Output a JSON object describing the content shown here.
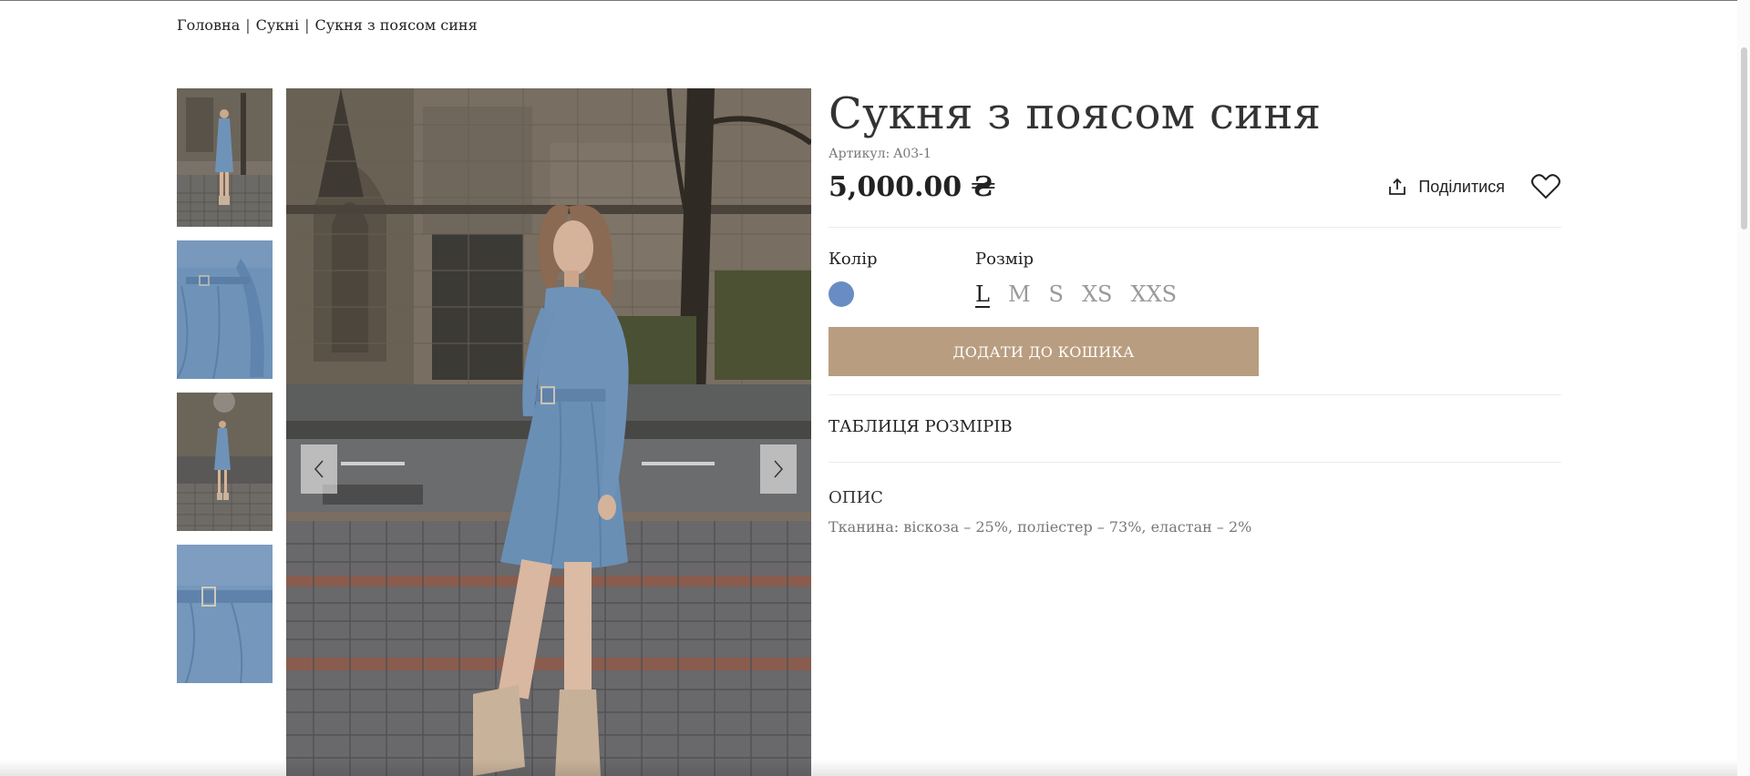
{
  "breadcrumb": {
    "home": "Головна",
    "category": "Сукні",
    "current": "Сукня з поясом синя",
    "separator": "|"
  },
  "product": {
    "title": "Сукня з поясом синя",
    "sku_label": "Артикул:",
    "sku": "A03-1",
    "price": "5,000.00 ₴",
    "share_label": "Поділитися",
    "color_label": "Колір",
    "color_swatch": "#6a8cc4",
    "size_label": "Розмір",
    "sizes": [
      "L",
      "M",
      "S",
      "XS",
      "XXS"
    ],
    "selected_size": "L",
    "add_to_cart": "ДОДАТИ ДО КОШИКА",
    "size_table": "ТАБЛИЦЯ РОЗМІРІВ",
    "description_title": "ОПИС",
    "description_text": "Тканина: віскоза – 25%, поліестер – 73%, еластан – 2%"
  },
  "icons": {
    "share": "share-icon",
    "favorite": "heart-icon",
    "prev": "chevron-left-icon",
    "next": "chevron-right-icon"
  },
  "colors": {
    "accent_button": "#b99d80",
    "dress": "#6f93b8"
  }
}
